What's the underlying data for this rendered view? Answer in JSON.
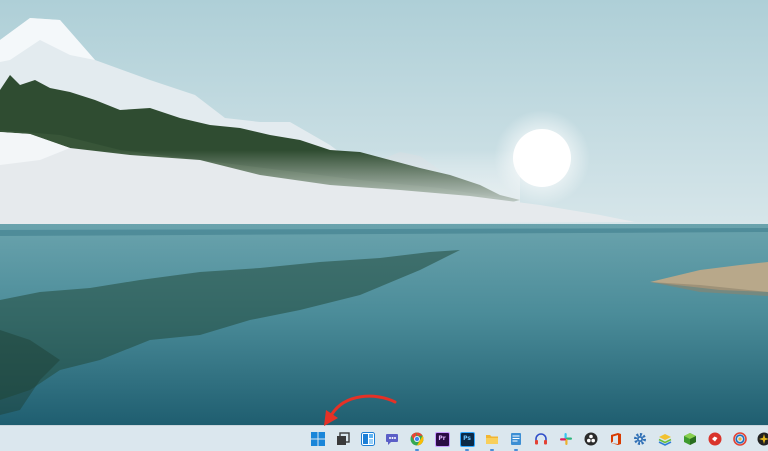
{
  "desktop": {
    "wallpaper": "lake-landscape",
    "colors": {
      "sky_top": "#b7d4da",
      "sky_bottom": "#d4e4e8",
      "water_top": "#5f99a4",
      "water_bottom": "#1f5c6e",
      "snow": "#e7eef1",
      "forest": "#2d4a30"
    }
  },
  "taskbar": {
    "background": "#dbe7ee",
    "items": [
      {
        "name": "start-button",
        "icon": "windows-logo-icon",
        "glyph": "",
        "color": "#1a86d9",
        "running": false
      },
      {
        "name": "task-view-button",
        "icon": "task-view-icon",
        "glyph": "",
        "color": "#3a3a3a",
        "running": false
      },
      {
        "name": "widgets-button",
        "icon": "widgets-icon",
        "glyph": "",
        "color": "#1c7fd6",
        "running": false
      },
      {
        "name": "teams-chat-button",
        "icon": "chat-icon",
        "glyph": "",
        "color": "#5b5fc7",
        "running": false
      },
      {
        "name": "chrome-button",
        "icon": "chrome-icon",
        "glyph": "",
        "color": "#e34234",
        "running": true
      },
      {
        "name": "premiere-pro-button",
        "icon": "premiere-pro-icon",
        "glyph": "Pr",
        "color": "#2a0b45",
        "running": false
      },
      {
        "name": "photoshop-button",
        "icon": "photoshop-icon",
        "glyph": "Ps",
        "color": "#0b2a47",
        "running": true
      },
      {
        "name": "file-explorer-button",
        "icon": "folder-icon",
        "glyph": "",
        "color": "#f2b632",
        "running": true
      },
      {
        "name": "notepad-button",
        "icon": "notepad-icon",
        "glyph": "",
        "color": "#3d8fd4",
        "running": true
      },
      {
        "name": "headset-app-button",
        "icon": "headphones-icon",
        "glyph": "",
        "color": "#2f4ec9",
        "running": false
      },
      {
        "name": "slack-button",
        "icon": "slack-icon",
        "glyph": "",
        "color": "#e01e5a",
        "running": false
      },
      {
        "name": "obs-button",
        "icon": "obs-icon",
        "glyph": "",
        "color": "#2b2b2b",
        "running": false
      },
      {
        "name": "office-button",
        "icon": "office-icon",
        "glyph": "",
        "color": "#d83b01",
        "running": false
      },
      {
        "name": "settings-button",
        "icon": "gear-icon",
        "glyph": "",
        "color": "#2f6fb5",
        "running": false
      },
      {
        "name": "bluestacks-button",
        "icon": "bluestacks-icon",
        "glyph": "",
        "color": "#6bbf3a",
        "running": false
      },
      {
        "name": "green-app-button",
        "icon": "green-cube-icon",
        "glyph": "",
        "color": "#3f9b2e",
        "running": false
      },
      {
        "name": "red-app-button",
        "icon": "red-circle-icon",
        "glyph": "",
        "color": "#d9342b",
        "running": false
      },
      {
        "name": "circular-app-button",
        "icon": "ring-icon",
        "glyph": "",
        "color": "#1e6fbf",
        "running": false
      },
      {
        "name": "yellow-app-button",
        "icon": "yellow-app-icon",
        "glyph": "",
        "color": "#e0b51d",
        "running": false
      }
    ]
  },
  "annotation": {
    "icon": "curved-arrow-icon",
    "color": "#e53126"
  }
}
